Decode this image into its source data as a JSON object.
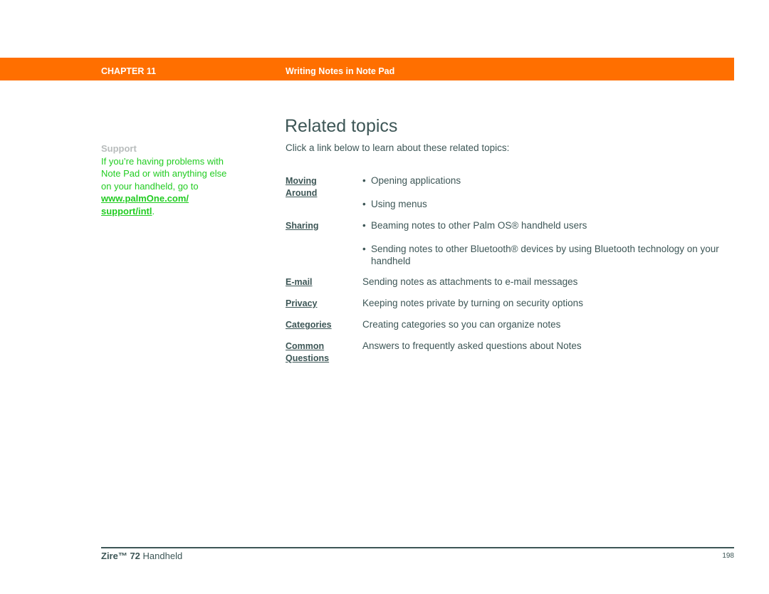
{
  "header": {
    "chapter": "CHAPTER 11",
    "chapter_title": "Writing Notes in Note Pad",
    "accent": "#ff6f00"
  },
  "sidebar": {
    "heading": "Support",
    "text": "If you’re having problems with Note Pad or with anything else on your handheld, go to ",
    "link": "www.palmOne.com/ support/intl",
    "end": "."
  },
  "main": {
    "title": "Related topics",
    "intro": "Click a link below to learn about these related topics:",
    "topics": [
      {
        "link": "Moving Around",
        "items": [
          "Opening applications",
          "Using menus"
        ]
      },
      {
        "link": "Sharing",
        "items": [
          "Beaming notes to other Palm OS® handheld users",
          "Sending notes to other Bluetooth® devices by using Bluetooth technology on your handheld"
        ]
      },
      {
        "link": "E-mail",
        "desc": "Sending notes as attachments to e-mail messages"
      },
      {
        "link": "Privacy",
        "desc": "Keeping notes private by turning on security options"
      },
      {
        "link": "Categories",
        "desc": "Creating categories so you can organize notes"
      },
      {
        "link": "Common Questions",
        "desc": "Answers to frequently asked questions about Notes"
      }
    ]
  },
  "footer": {
    "product_bold": "Zire™ 72",
    "product_rest": " Handheld",
    "page": "198"
  }
}
